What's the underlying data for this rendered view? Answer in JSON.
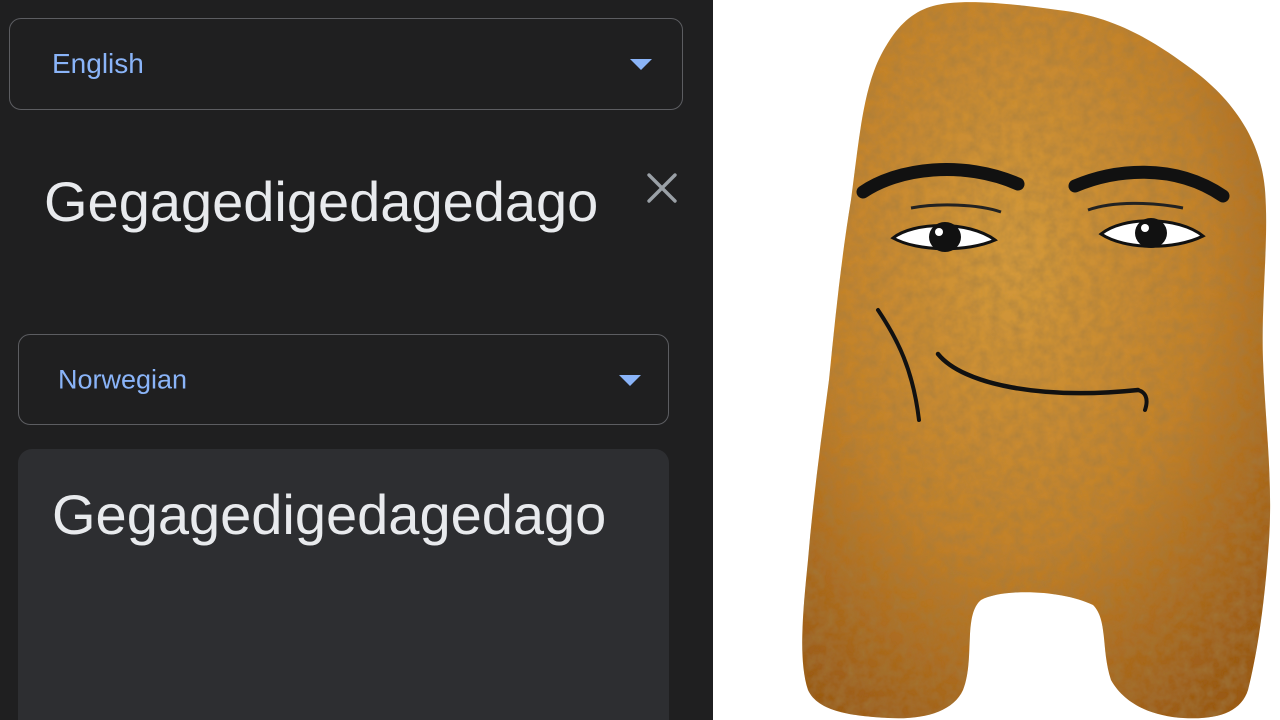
{
  "translator": {
    "source_language": "English",
    "target_language": "Norwegian",
    "source_text": "Gegagedigedagedago",
    "translated_text": "Gegagedigedagedago"
  },
  "icons": {
    "source_dropdown": "chevron-down-icon",
    "target_dropdown": "chevron-down-icon",
    "clear": "close-icon"
  },
  "colors": {
    "panel_background": "#1f1f20",
    "output_background": "#2d2e31",
    "accent": "#8ab4f8",
    "text": "#e8eaed",
    "nugget": "#c98a2e"
  }
}
